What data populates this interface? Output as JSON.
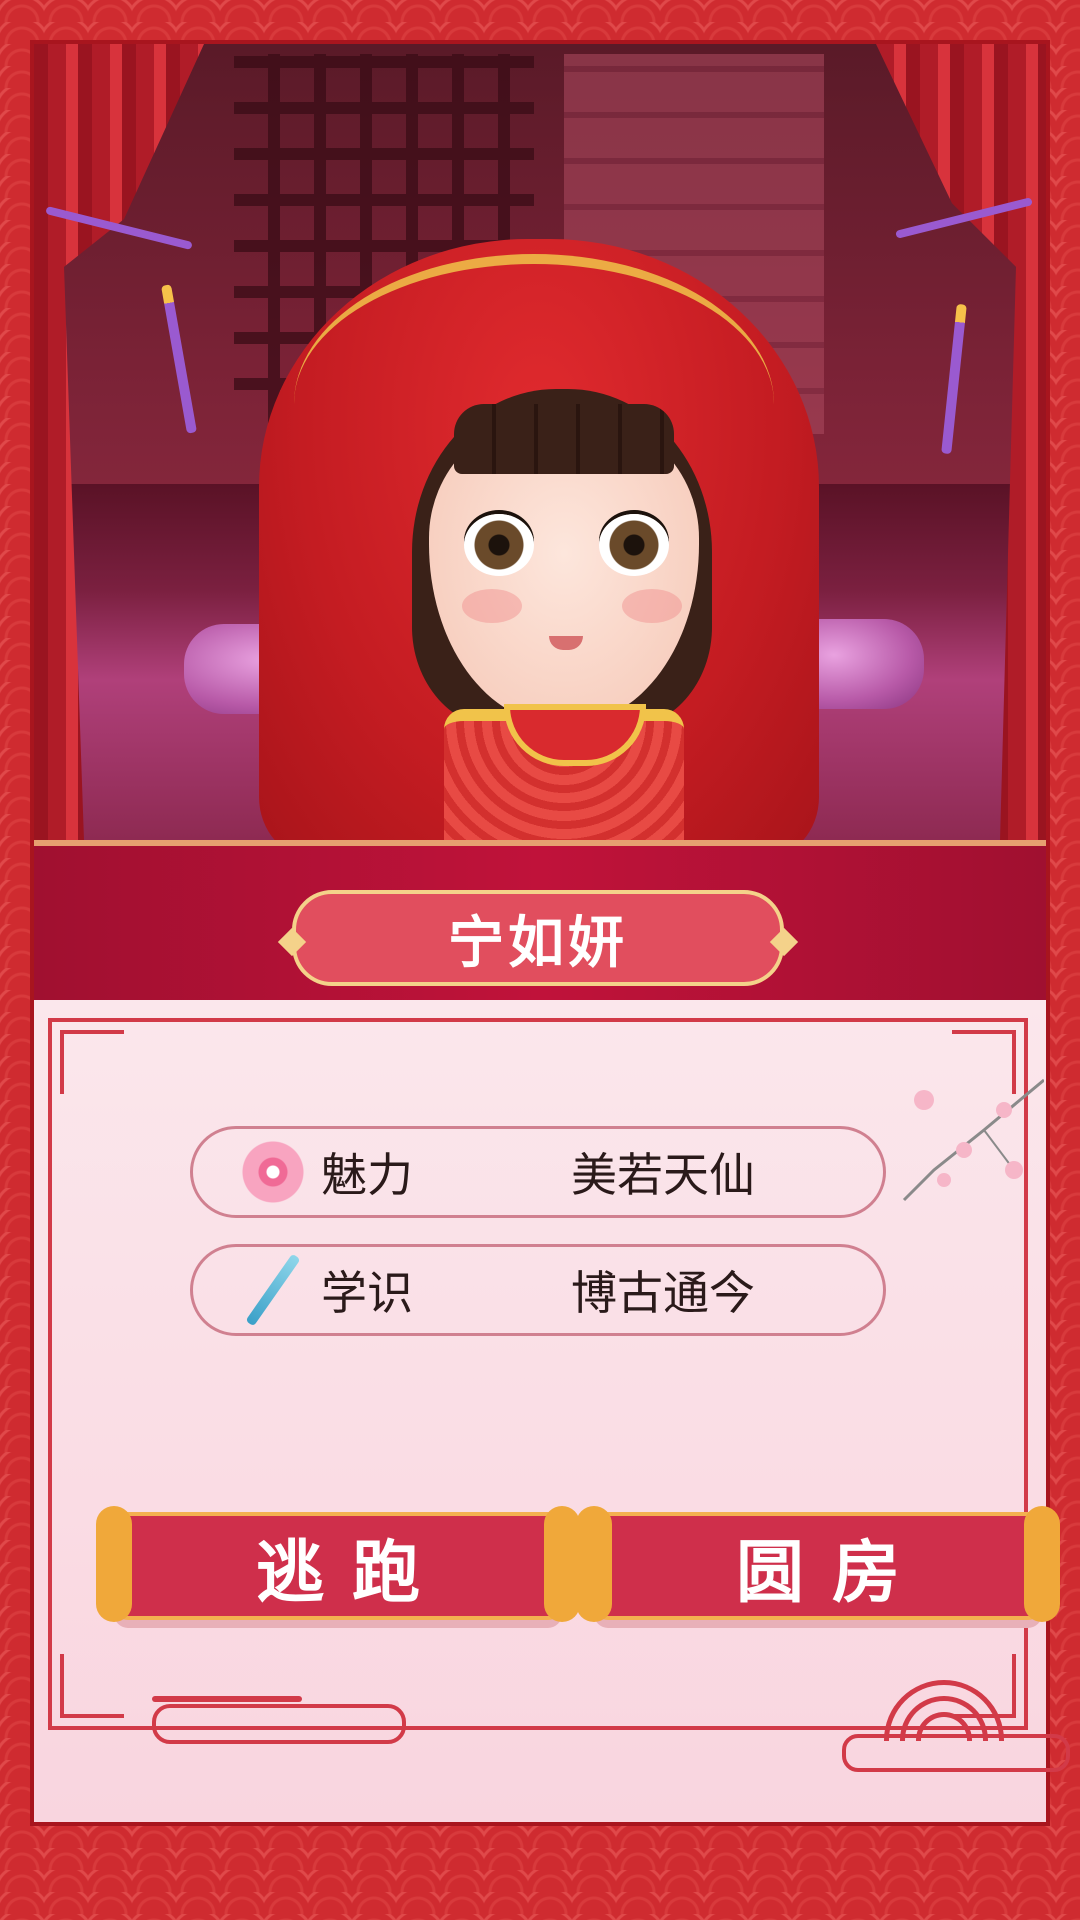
{
  "character": {
    "name": "宁如妍"
  },
  "stats": [
    {
      "icon": "plum-blossom-icon",
      "label": "魅力",
      "value": "美若天仙"
    },
    {
      "icon": "brush-pen-icon",
      "label": "学识",
      "value": "博古通今"
    }
  ],
  "actions": {
    "escape_label": "逃跑",
    "consummate_label": "圆房"
  },
  "colors": {
    "border_red": "#cf2b30",
    "banner_red": "#c0123a",
    "plate_pink": "#e14e5e",
    "button_red": "#cf2f4b",
    "gold": "#f4b050",
    "panel_pink": "#fbe7ec"
  }
}
